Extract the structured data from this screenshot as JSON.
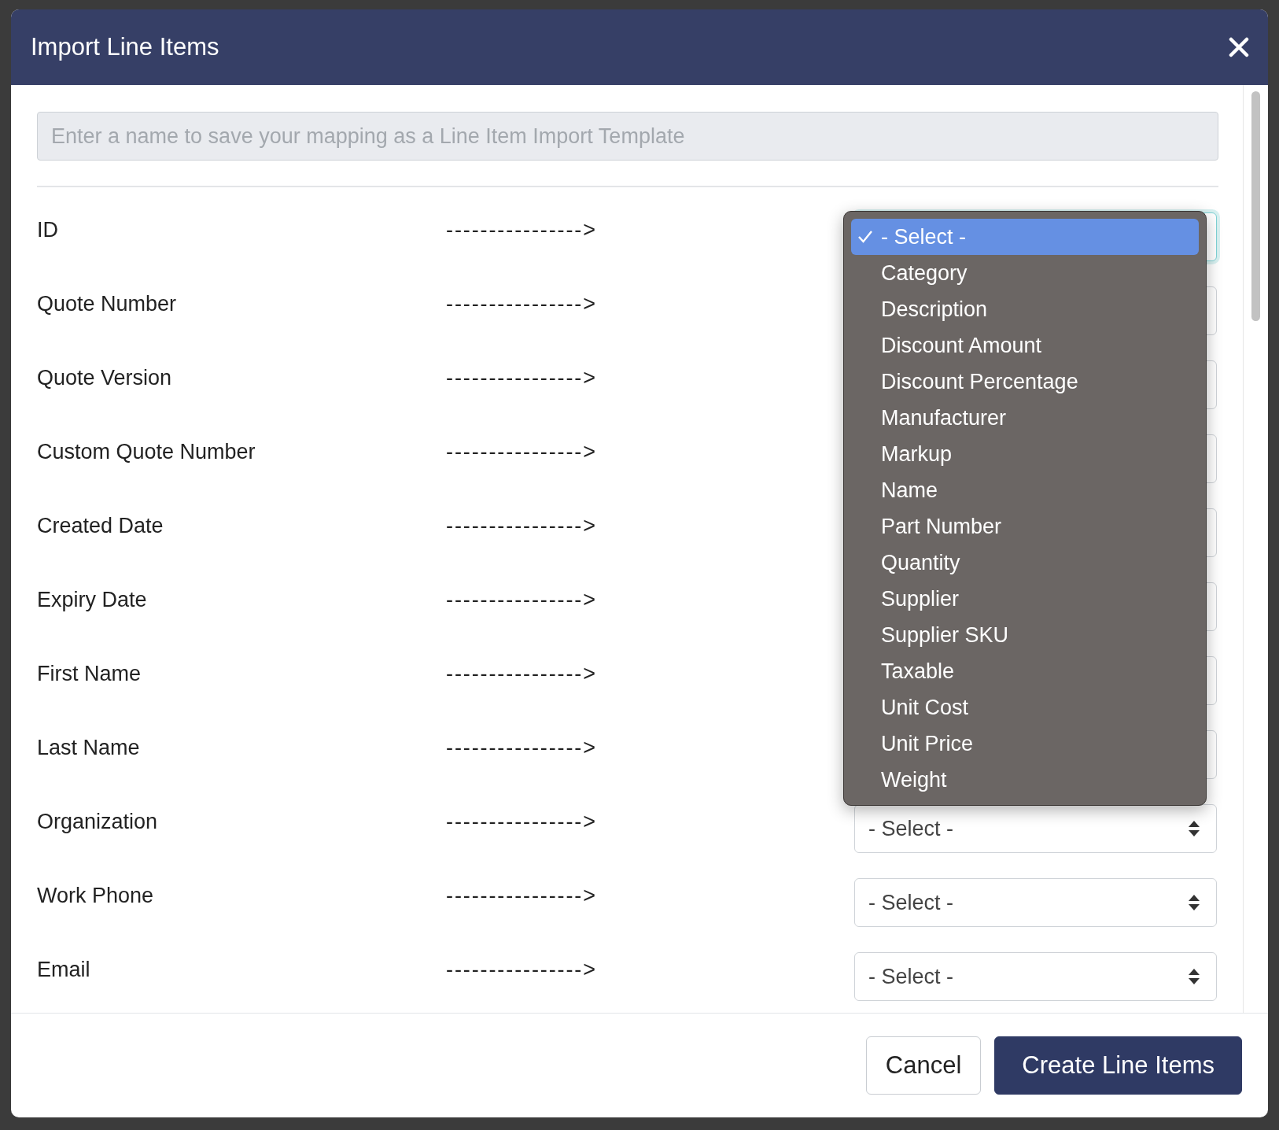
{
  "dialog": {
    "title": "Import Line Items"
  },
  "template_name": {
    "placeholder": "Enter a name to save your mapping as a Line Item Import Template"
  },
  "rows": [
    {
      "label": "ID",
      "arrow": "---------------->",
      "focused": true
    },
    {
      "label": "Quote Number",
      "arrow": "---------------->",
      "focused": false
    },
    {
      "label": "Quote Version",
      "arrow": "---------------->",
      "focused": false
    },
    {
      "label": "Custom Quote Number",
      "arrow": "---------------->",
      "focused": false
    },
    {
      "label": "Created Date",
      "arrow": "---------------->",
      "focused": false
    },
    {
      "label": "Expiry Date",
      "arrow": "---------------->",
      "focused": false
    },
    {
      "label": "First Name",
      "arrow": "---------------->",
      "focused": false
    },
    {
      "label": "Last Name",
      "arrow": "---------------->",
      "focused": false
    },
    {
      "label": "Organization",
      "arrow": "---------------->",
      "value": "- Select -",
      "focused": false
    },
    {
      "label": "Work Phone",
      "arrow": "---------------->",
      "value": "- Select -",
      "focused": false
    },
    {
      "label": "Email",
      "arrow": "---------------->",
      "value": "- Select -",
      "focused": false
    }
  ],
  "dropdown": {
    "options": [
      {
        "label": "- Select -",
        "selected": true
      },
      {
        "label": "Category",
        "selected": false
      },
      {
        "label": "Description",
        "selected": false
      },
      {
        "label": "Discount Amount",
        "selected": false
      },
      {
        "label": "Discount Percentage",
        "selected": false
      },
      {
        "label": "Manufacturer",
        "selected": false
      },
      {
        "label": "Markup",
        "selected": false
      },
      {
        "label": "Name",
        "selected": false
      },
      {
        "label": "Part Number",
        "selected": false
      },
      {
        "label": "Quantity",
        "selected": false
      },
      {
        "label": "Supplier",
        "selected": false
      },
      {
        "label": "Supplier SKU",
        "selected": false
      },
      {
        "label": "Taxable",
        "selected": false
      },
      {
        "label": "Unit Cost",
        "selected": false
      },
      {
        "label": "Unit Price",
        "selected": false
      },
      {
        "label": "Weight",
        "selected": false
      }
    ]
  },
  "buttons": [
    {
      "label": "Cancel",
      "kind": "secondary"
    },
    {
      "label": "Create Line Items",
      "kind": "primary"
    }
  ]
}
